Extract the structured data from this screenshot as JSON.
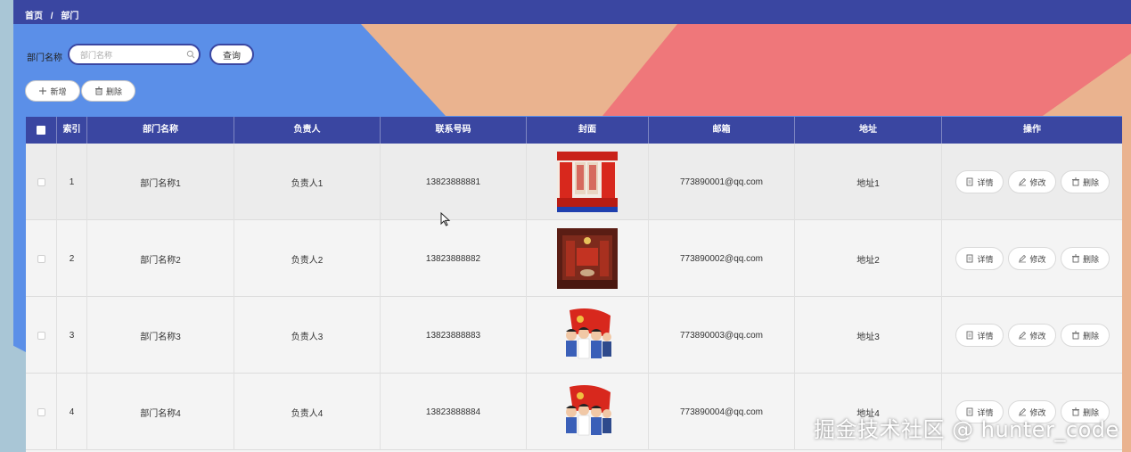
{
  "breadcrumb": {
    "home": "首页",
    "separator": "/",
    "current": "部门"
  },
  "search": {
    "label": "部门名称",
    "placeholder": "部门名称",
    "value": "",
    "button": "查询"
  },
  "toolbar": {
    "add_label": "新增",
    "delete_label": "删除"
  },
  "table": {
    "headers": {
      "index": "索引",
      "name": "部门名称",
      "leader": "负责人",
      "phone": "联系号码",
      "cover": "封面",
      "email": "邮箱",
      "address": "地址",
      "actions": "操作"
    },
    "rows": [
      {
        "index": "1",
        "name": "部门名称1",
        "leader": "负责人1",
        "phone": "13823888881",
        "email": "773890001@qq.com",
        "address": "地址1",
        "cover": "poster"
      },
      {
        "index": "2",
        "name": "部门名称2",
        "leader": "负责人2",
        "phone": "13823888882",
        "email": "773890002@qq.com",
        "address": "地址2",
        "cover": "hall"
      },
      {
        "index": "3",
        "name": "部门名称3",
        "leader": "负责人3",
        "phone": "13823888883",
        "email": "773890003@qq.com",
        "address": "地址3",
        "cover": "people-flag"
      },
      {
        "index": "4",
        "name": "部门名称4",
        "leader": "负责人4",
        "phone": "13823888884",
        "email": "773890004@qq.com",
        "address": "地址4",
        "cover": "people-flag"
      }
    ],
    "row_actions": {
      "detail": "详情",
      "edit": "修改",
      "delete": "删除"
    }
  },
  "watermark": "掘金技术社区 @ hunter_code",
  "colors": {
    "header": "#3a46a1",
    "bg_blue": "#5b8fe8",
    "bg_peach": "#eab38f",
    "bg_red": "#ef777a"
  },
  "icons": {
    "search": "search-icon",
    "add": "plus-icon",
    "delete": "trash-icon",
    "detail": "document-icon",
    "edit": "pencil-icon",
    "cursor": "mouse-cursor-icon"
  }
}
